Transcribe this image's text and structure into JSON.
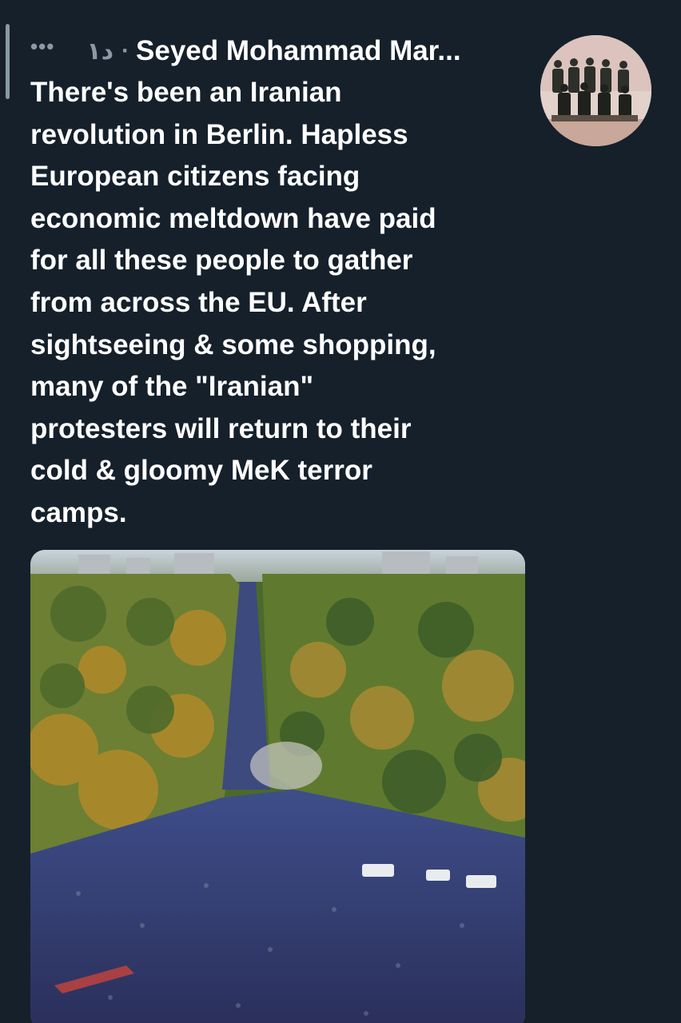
{
  "tweet": {
    "more_icon": "ellipsis-icon",
    "timestamp": "۱د",
    "separator": "·",
    "author_name": "Seyed Mohammad Mar...",
    "text": "There's been an Iranian\nrevolution in Berlin. Hapless\nEuropean citizens facing\neconomic meltdown have paid\nfor all these people to gather\nfrom across the EU. After\nsightseeing & some shopping,\nmany of the \"Iranian\"\nprotesters will return to their\ncold & gloomy MeK terror\ncamps."
  },
  "colors": {
    "background": "#15202b",
    "text_primary": "#ffffff",
    "text_secondary": "#8b98a5"
  }
}
